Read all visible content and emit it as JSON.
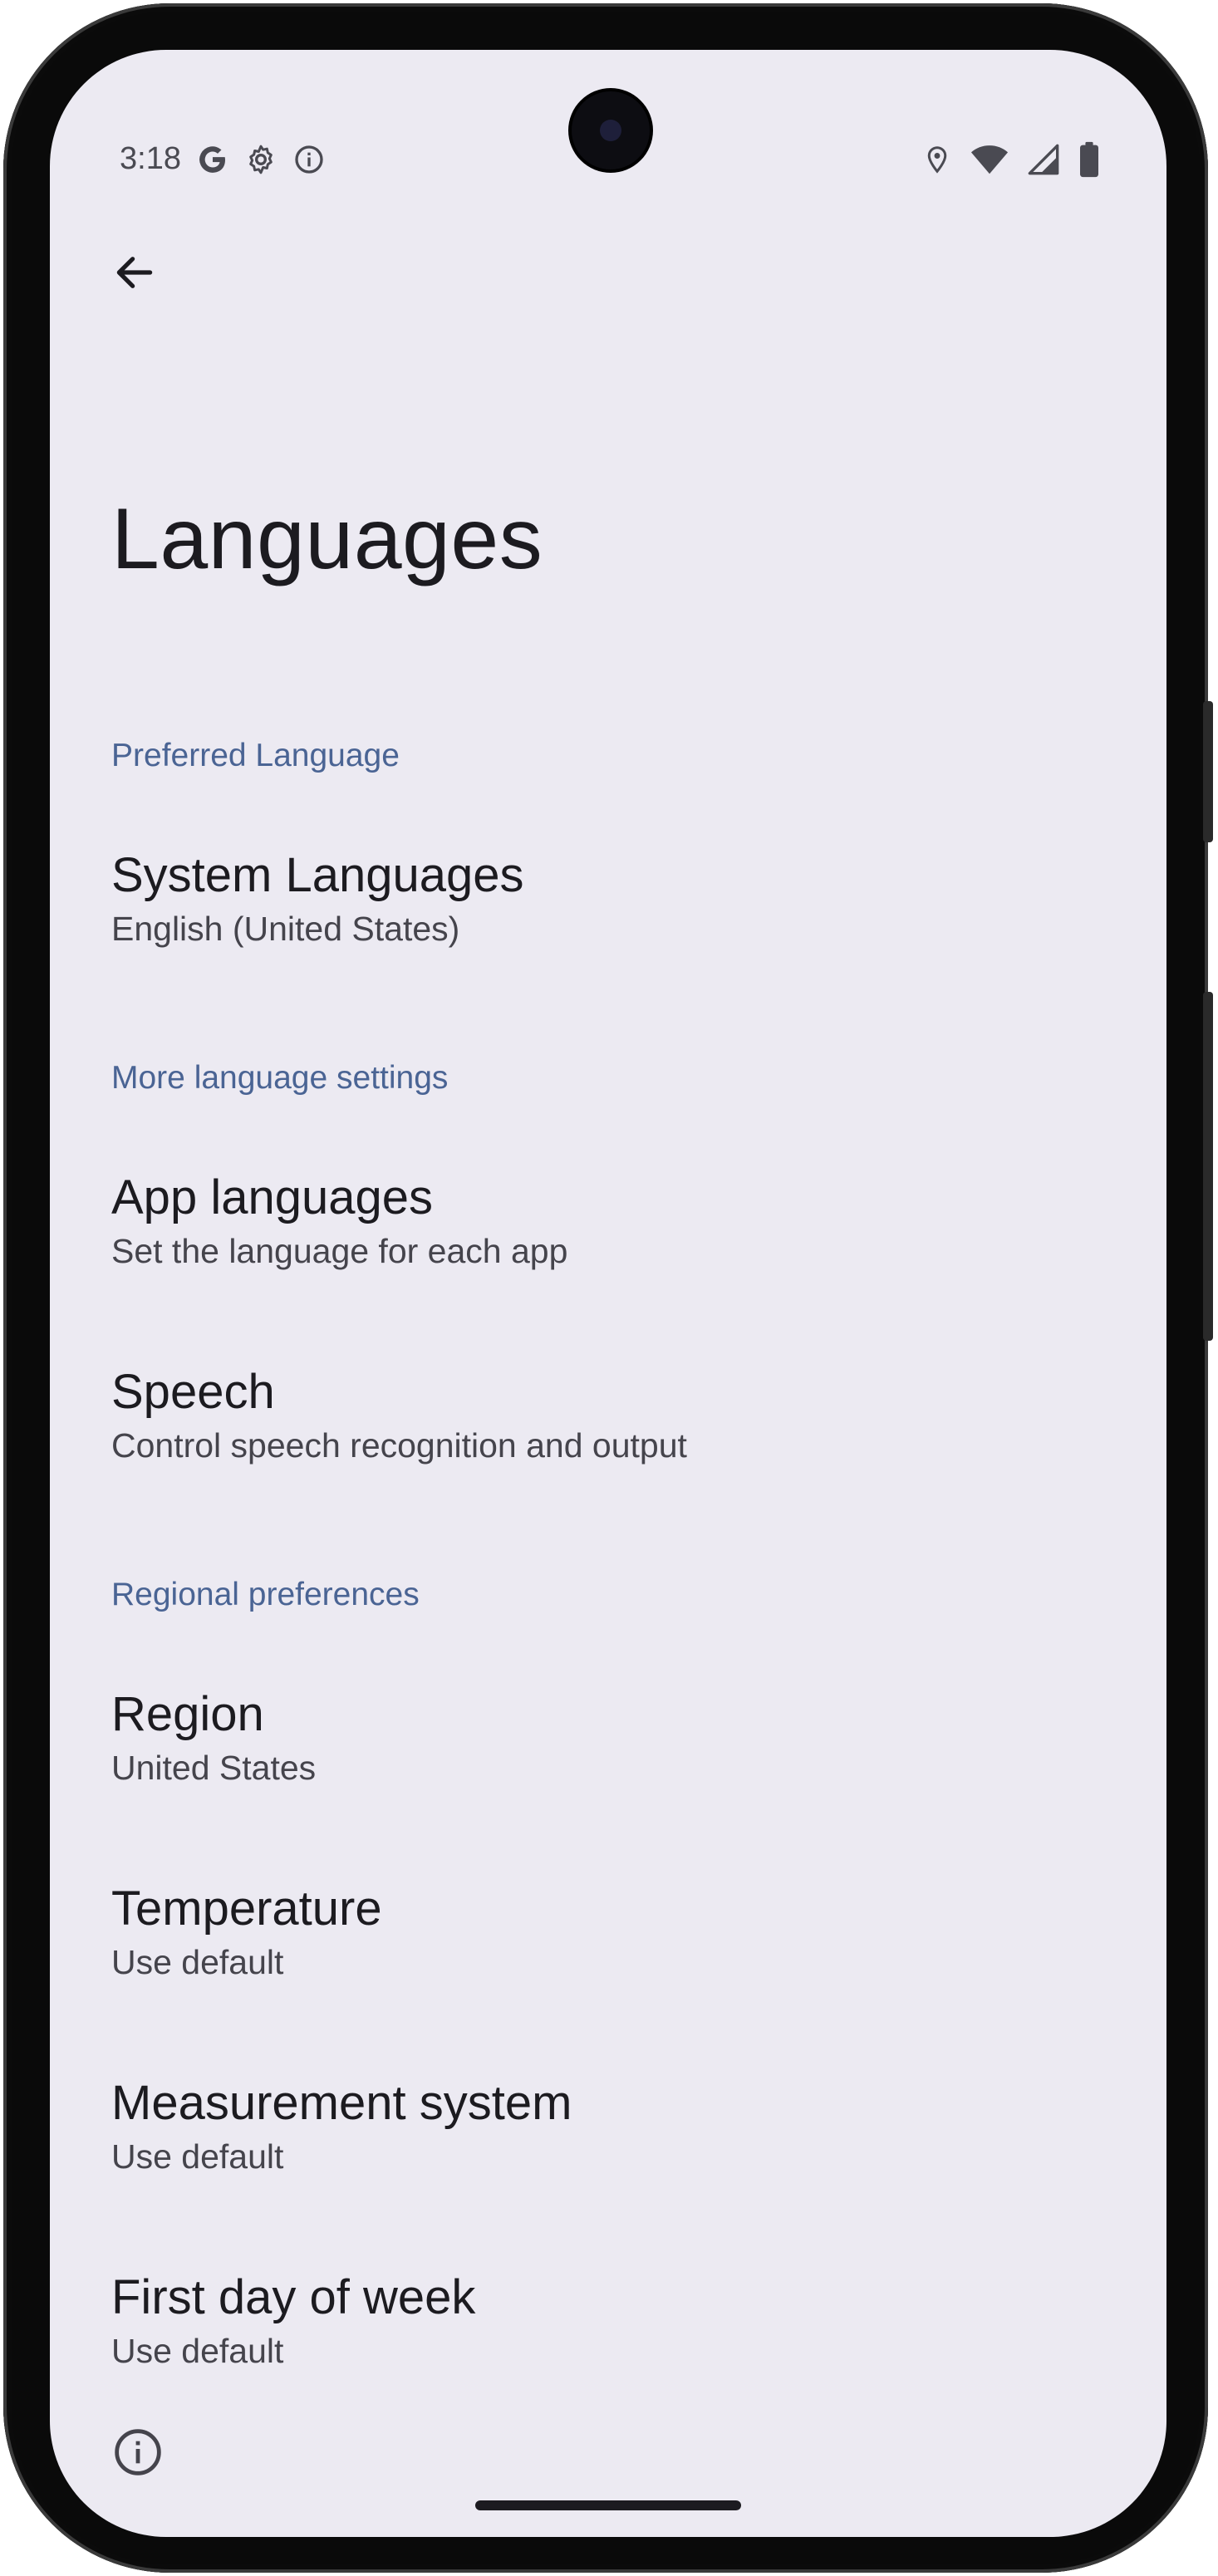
{
  "status_bar": {
    "time": "3:18",
    "left_icons": [
      "google-g-icon",
      "settings-gear-icon",
      "info-icon"
    ],
    "right_icons": [
      "location-icon",
      "wifi-icon",
      "signal-icon",
      "battery-icon"
    ]
  },
  "header": {
    "back_icon": "arrow-left-icon",
    "title": "Languages"
  },
  "sections": {
    "preferred": {
      "header": "Preferred Language",
      "system_languages": {
        "title": "System Languages",
        "subtitle": "English (United States)"
      }
    },
    "more": {
      "header": "More language settings",
      "app_languages": {
        "title": "App languages",
        "subtitle": "Set the language for each app"
      },
      "speech": {
        "title": "Speech",
        "subtitle": "Control speech recognition and output"
      }
    },
    "regional": {
      "header": "Regional preferences",
      "region": {
        "title": "Region",
        "subtitle": "United States"
      },
      "temperature": {
        "title": "Temperature",
        "subtitle": "Use default"
      },
      "measurement": {
        "title": "Measurement system",
        "subtitle": "Use default"
      },
      "first_day": {
        "title": "First day of week",
        "subtitle": "Use default"
      }
    }
  },
  "footer": {
    "info_icon": "info-outline-icon"
  },
  "colors": {
    "background": "#eceaf2",
    "section_header": "#4a6494",
    "primary_text": "#1c1b20",
    "secondary_text": "#45444c"
  }
}
